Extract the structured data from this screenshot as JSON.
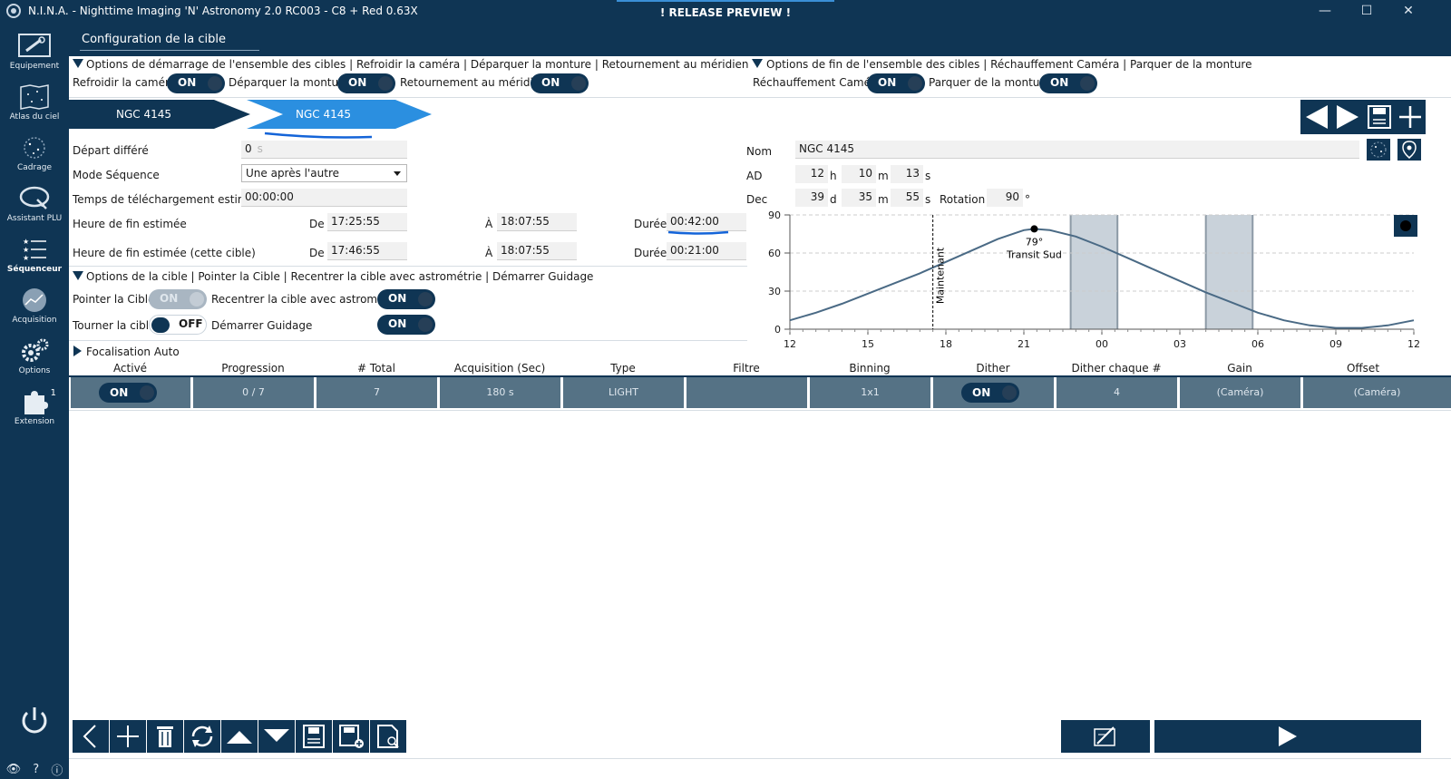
{
  "window": {
    "title": "N.I.N.A. - Nighttime Imaging 'N' Astronomy 2.0 RC003  -  C8 + Red 0.63X",
    "banner": "! RELEASE PREVIEW !",
    "minimize": "—",
    "maximize": "☐",
    "close": "✕"
  },
  "nav": {
    "items": [
      {
        "label": "Equipement",
        "icon": "telescope-icon"
      },
      {
        "label": "Atlas du ciel",
        "icon": "sky-atlas-icon"
      },
      {
        "label": "Cadrage",
        "icon": "framing-icon"
      },
      {
        "label": "Assistant PLU",
        "icon": "flat-wizard-icon"
      },
      {
        "label": "Séquenceur",
        "icon": "sequencer-icon"
      },
      {
        "label": "Acquisition",
        "icon": "imaging-icon"
      },
      {
        "label": "Options",
        "icon": "gear-icon"
      },
      {
        "label": "Extension",
        "icon": "puzzle-icon"
      }
    ],
    "extension_badge": "1",
    "bottom": {
      "eye": "👁",
      "help": "?",
      "info": "ⓘ"
    }
  },
  "page_title": "Configuration de la cible",
  "start_options": {
    "header": "Options de démarrage de l'ensemble des cibles   | Refroidir la caméra | Déparquer la monture | Retournement au méridien",
    "items": [
      {
        "label": "Refroidir la caméra",
        "state": "ON"
      },
      {
        "label": "Déparquer la monture",
        "state": "ON"
      },
      {
        "label": "Retournement au méridien",
        "state": "ON"
      }
    ]
  },
  "end_options": {
    "header": "Options de fin de l'ensemble des cibles | Réchauffement Caméra | Parquer de la monture",
    "items": [
      {
        "label": "Réchauffement Caméra",
        "state": "ON"
      },
      {
        "label": "Parquer de la monture",
        "state": "ON"
      }
    ]
  },
  "tabs": [
    {
      "label": "NGC 4145",
      "active": false
    },
    {
      "label": "NGC 4145",
      "active": true
    }
  ],
  "sequence": {
    "delay_label": "Départ différé",
    "delay_value": "0",
    "delay_unit": "s",
    "mode_label": "Mode Séquence",
    "mode_value": "Une après l'autre",
    "download_label": "Temps de téléchargement estimé",
    "download_value": "00:00:00",
    "end_label": "Heure de fin estimée",
    "end_target_label": "Heure de fin estimée (cette cible)",
    "from_label": "De",
    "to_label": "À",
    "duration_label": "Durée",
    "end_from": "17:25:55",
    "end_to": "18:07:55",
    "end_duration": "00:42:00",
    "target_from": "17:46:55",
    "target_to": "18:07:55",
    "target_duration": "00:21:00"
  },
  "target_options": {
    "header": "Options de la cible | Pointer la Cible | Recentrer la cible avec astrométrie | Démarrer Guidage",
    "slew_label": "Pointer la Cible",
    "slew_state": "ON",
    "center_label": "Recentrer la cible avec astrométrie",
    "center_state": "ON",
    "rotate_label": "Tourner la cible",
    "rotate_state": "OFF",
    "guide_label": "Démarrer Guidage",
    "guide_state": "ON"
  },
  "autofocus": {
    "header": "Focalisation Auto"
  },
  "coords": {
    "name_label": "Nom",
    "name_value": "NGC 4145",
    "ra_label": "AD",
    "ra_h": "12",
    "ra_h_unit": "h",
    "ra_m": "10",
    "ra_m_unit": "m",
    "ra_s": "13",
    "ra_s_unit": "s",
    "dec_label": "Dec",
    "dec_d": "39",
    "dec_d_unit": "d",
    "dec_m": "35",
    "dec_m_unit": "m",
    "dec_s": "55",
    "dec_s_unit": "s",
    "rotation_label": "Rotation",
    "rotation_value": "90",
    "rotation_unit": "°"
  },
  "chart_data": {
    "type": "line",
    "title": "",
    "xlabel": "",
    "ylabel": "",
    "x_ticks": [
      "12",
      "15",
      "18",
      "21",
      "00",
      "03",
      "06",
      "09",
      "12"
    ],
    "y_ticks": [
      "0",
      "30",
      "60",
      "90"
    ],
    "ylim": [
      0,
      90
    ],
    "grid": true,
    "series": [
      {
        "x": [
          12,
          13,
          14,
          15,
          16,
          17,
          18,
          19,
          20,
          21,
          21.4,
          22,
          23,
          24,
          25,
          26,
          27,
          28,
          29,
          30,
          31,
          32,
          33,
          34,
          35,
          36
        ],
        "values": [
          7,
          13,
          20,
          28,
          36,
          44,
          53,
          62,
          71,
          78,
          79,
          78,
          73,
          65,
          56,
          47,
          38,
          29,
          21,
          13,
          7,
          3,
          1,
          1,
          3,
          7
        ]
      }
    ],
    "now_marker": {
      "x": 17.5,
      "label": "Maintenant"
    },
    "transit": {
      "x": 21.4,
      "y": 79,
      "value_label": "79°",
      "label": "Transit Sud"
    },
    "night_bands": [
      [
        22.8,
        24.6
      ],
      [
        28.0,
        29.8
      ]
    ]
  },
  "grid": {
    "headers": [
      "Activé",
      "Progression",
      "# Total",
      "Acquisition (Sec)",
      "Type",
      "Filtre",
      "Binning",
      "Dither",
      "Dither chaque #",
      "Gain",
      "Offset"
    ],
    "row": {
      "enabled": "ON",
      "progress": "0 / 7",
      "total": "7",
      "exposure": "180 s",
      "type": "LIGHT",
      "filter": "",
      "binning": "1x1",
      "dither": "ON",
      "dither_every": "4",
      "gain": "(Caméra)",
      "offset": "(Caméra)"
    }
  },
  "colors": {
    "accent": "#0f3554",
    "tab_active": "#2b8fe0",
    "plot_line": "#4a6a85",
    "night_band": "#c9d2da"
  }
}
